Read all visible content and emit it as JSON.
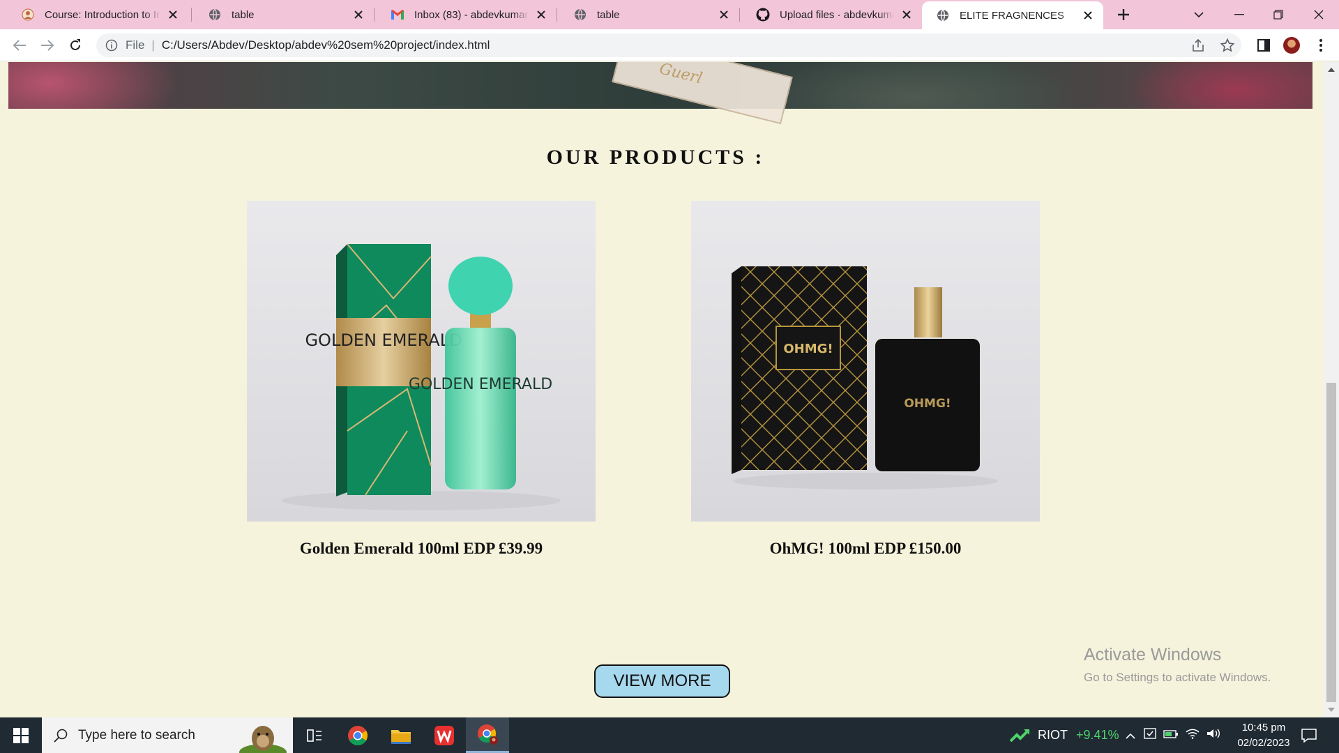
{
  "browser": {
    "tabs": [
      {
        "title": "Course: Introduction to Info",
        "favicon": "course-icon",
        "active": false
      },
      {
        "title": "table",
        "favicon": "globe-icon",
        "active": false
      },
      {
        "title": "Inbox (83) - abdevkumar21",
        "favicon": "gmail-icon",
        "active": false
      },
      {
        "title": "table",
        "favicon": "globe-icon",
        "active": false
      },
      {
        "title": "Upload files · abdevkumar/",
        "favicon": "github-icon",
        "active": false
      },
      {
        "title": "ELITE FRAGNENCES",
        "favicon": "globe-icon",
        "active": true
      }
    ],
    "address": {
      "scheme": "File",
      "url": "C:/Users/Abdev/Desktop/abdev%20sem%20project/index.html"
    }
  },
  "page": {
    "section_title": "OUR  PRODUCTS :",
    "hero_card_text": "Guerl",
    "products": [
      {
        "name": "Golden Emerald 100ml EDP £39.99",
        "box_text": "GOLDEN EMERALD",
        "bottle_text": "GOLDEN EMERALD"
      },
      {
        "name": "OhMG! 100ml EDP £150.00",
        "box_text": "OHMG!",
        "bottle_text": "OHMG!"
      }
    ],
    "view_more": "VIEW MORE"
  },
  "watermark": {
    "line1": "Activate Windows",
    "line2": "Go to Settings to activate Windows."
  },
  "taskbar": {
    "search_placeholder": "Type here to search",
    "stock_name": "RIOT",
    "stock_change": "+9.41%",
    "time": "10:45 pm",
    "date": "02/02/2023"
  },
  "colors": {
    "tab_strip": "#f2c5d9",
    "page_bg": "#f5f3dc",
    "button_bg": "#a6d8ee",
    "taskbar": "#1f2a33",
    "stock_up": "#4fd16b"
  }
}
